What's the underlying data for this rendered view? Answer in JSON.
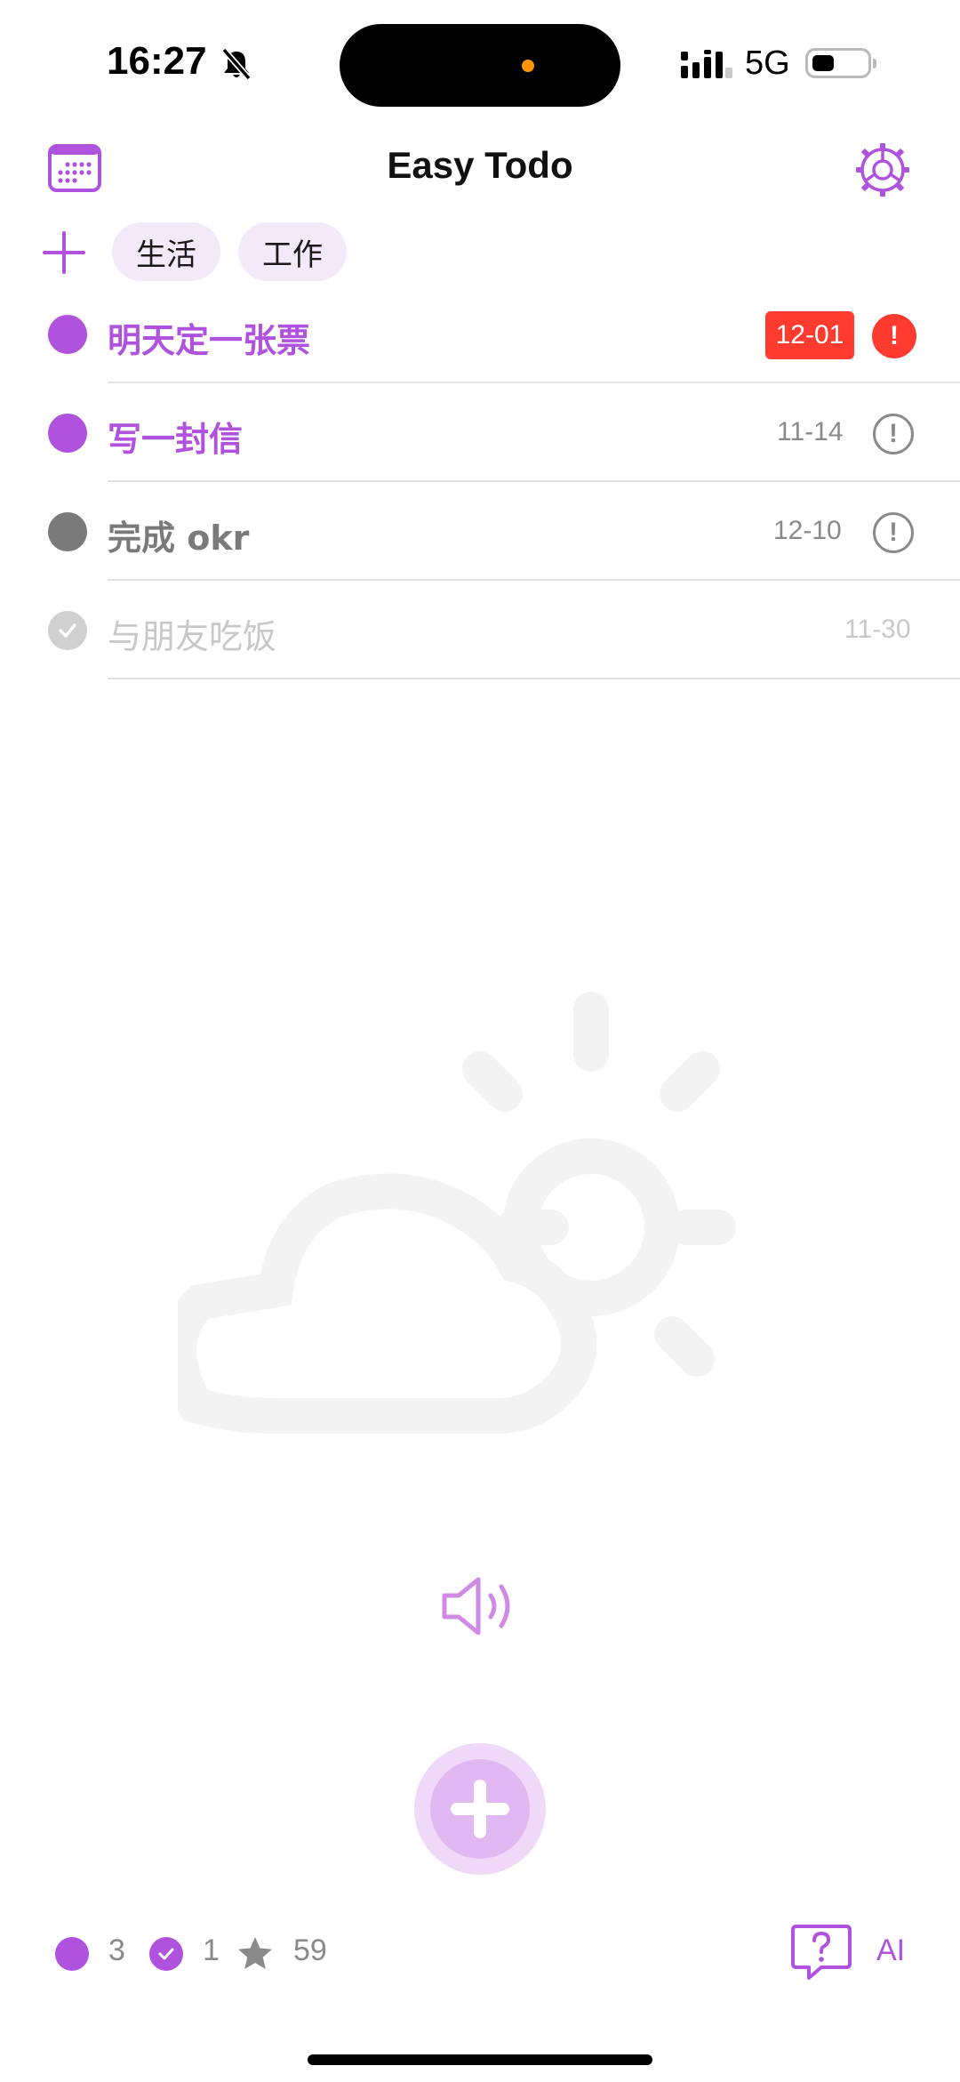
{
  "status_bar": {
    "time": "16:27",
    "network": "5G",
    "silent_icon": "bell-slash-icon",
    "signal_icon": "cellular-signal-icon",
    "battery_icon": "battery-low-icon"
  },
  "header": {
    "title": "Easy Todo",
    "calendar_icon": "calendar-icon",
    "settings_icon": "gear-icon"
  },
  "tags": {
    "add_icon": "plus-icon",
    "items": [
      "生活",
      "工作"
    ]
  },
  "todos": [
    {
      "title": "明天定一张票",
      "date": "12-01",
      "state": "open",
      "color": "#af52de",
      "priority": "high",
      "priority_symbol": "!"
    },
    {
      "title": "写一封信",
      "date": "11-14",
      "state": "open",
      "color": "#af52de",
      "priority": "normal",
      "priority_symbol": "!"
    },
    {
      "title": "完成 okr",
      "date": "12-10",
      "state": "open",
      "color": "#7a7a7a",
      "priority": "normal",
      "priority_symbol": "!"
    },
    {
      "title": "与朋友吃饭",
      "date": "11-30",
      "state": "done",
      "color": "#c8c8c8",
      "priority": "none"
    }
  ],
  "empty_illustration": "sun-behind-cloud-icon",
  "controls": {
    "speaker_icon": "speaker-icon",
    "add_icon": "add-todo-icon"
  },
  "footer": {
    "open_count": "3",
    "done_count": "1",
    "star_count": "59",
    "help_icon": "question-bubble-icon",
    "ai_label": "AI"
  },
  "colors": {
    "accent": "#af52de",
    "overdue": "#ff3b30",
    "chip_bg": "#f2eaf9"
  }
}
